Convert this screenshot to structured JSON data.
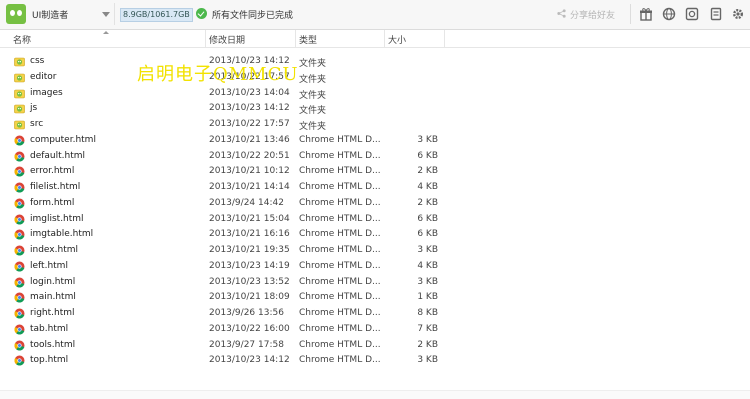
{
  "toolbar": {
    "user_name": "UI制造者",
    "storage": "8.9GB/1061.7GB",
    "sync_status": "所有文件同步已完成",
    "share_label": "分享给好友",
    "icons": [
      "gift-icon",
      "globe-icon",
      "screenshot-icon",
      "archive-icon",
      "gear-icon"
    ]
  },
  "header": {
    "name": "名称",
    "date": "修改日期",
    "type": "类型",
    "size": "大小"
  },
  "watermark": "启明电子QMMCU",
  "files": [
    {
      "name": "css",
      "date": "2013/10/23 14:12",
      "type": "文件夹",
      "size": "",
      "icon": "folder-icon"
    },
    {
      "name": "editor",
      "date": "2013/10/22 17:57",
      "type": "文件夹",
      "size": "",
      "icon": "folder-icon"
    },
    {
      "name": "images",
      "date": "2013/10/23 14:04",
      "type": "文件夹",
      "size": "",
      "icon": "folder-icon"
    },
    {
      "name": "js",
      "date": "2013/10/23 14:12",
      "type": "文件夹",
      "size": "",
      "icon": "folder-icon"
    },
    {
      "name": "src",
      "date": "2013/10/22 17:57",
      "type": "文件夹",
      "size": "",
      "icon": "folder-icon"
    },
    {
      "name": "computer.html",
      "date": "2013/10/21 13:46",
      "type": "Chrome HTML D...",
      "size": "3 KB",
      "icon": "chrome-file-icon"
    },
    {
      "name": "default.html",
      "date": "2013/10/22 20:51",
      "type": "Chrome HTML D...",
      "size": "6 KB",
      "icon": "chrome-file-icon"
    },
    {
      "name": "error.html",
      "date": "2013/10/21 10:12",
      "type": "Chrome HTML D...",
      "size": "2 KB",
      "icon": "chrome-file-icon"
    },
    {
      "name": "filelist.html",
      "date": "2013/10/21 14:14",
      "type": "Chrome HTML D...",
      "size": "4 KB",
      "icon": "chrome-file-icon"
    },
    {
      "name": "form.html",
      "date": "2013/9/24 14:42",
      "type": "Chrome HTML D...",
      "size": "2 KB",
      "icon": "chrome-file-icon"
    },
    {
      "name": "imglist.html",
      "date": "2013/10/21 15:04",
      "type": "Chrome HTML D...",
      "size": "6 KB",
      "icon": "chrome-file-icon"
    },
    {
      "name": "imgtable.html",
      "date": "2013/10/21 16:16",
      "type": "Chrome HTML D...",
      "size": "6 KB",
      "icon": "chrome-file-icon"
    },
    {
      "name": "index.html",
      "date": "2013/10/21 19:35",
      "type": "Chrome HTML D...",
      "size": "3 KB",
      "icon": "chrome-file-icon"
    },
    {
      "name": "left.html",
      "date": "2013/10/23 14:19",
      "type": "Chrome HTML D...",
      "size": "4 KB",
      "icon": "chrome-file-icon"
    },
    {
      "name": "login.html",
      "date": "2013/10/23 13:52",
      "type": "Chrome HTML D...",
      "size": "3 KB",
      "icon": "chrome-file-icon"
    },
    {
      "name": "main.html",
      "date": "2013/10/21 18:09",
      "type": "Chrome HTML D...",
      "size": "1 KB",
      "icon": "chrome-file-icon"
    },
    {
      "name": "right.html",
      "date": "2013/9/26 13:56",
      "type": "Chrome HTML D...",
      "size": "8 KB",
      "icon": "chrome-file-icon"
    },
    {
      "name": "tab.html",
      "date": "2013/10/22 16:00",
      "type": "Chrome HTML D...",
      "size": "7 KB",
      "icon": "chrome-file-icon"
    },
    {
      "name": "tools.html",
      "date": "2013/9/27 17:58",
      "type": "Chrome HTML D...",
      "size": "2 KB",
      "icon": "chrome-file-icon"
    },
    {
      "name": "top.html",
      "date": "2013/10/23 14:12",
      "type": "Chrome HTML D...",
      "size": "3 KB",
      "icon": "chrome-file-icon"
    }
  ]
}
